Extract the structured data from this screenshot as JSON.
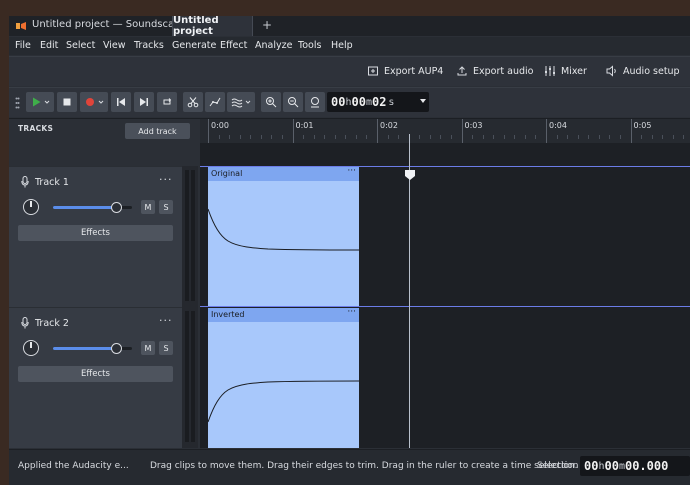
{
  "window": {
    "title": "Untitled project — Soundscaper",
    "project_tab": "Untitled project",
    "new_tab": "+"
  },
  "menu": [
    "File",
    "Edit",
    "Select",
    "View",
    "Tracks",
    "Generate",
    "Effect",
    "Analyze",
    "Tools",
    "Help"
  ],
  "actions": {
    "export_aup4": "Export AUP4",
    "export_audio": "Export audio",
    "mixer": "Mixer",
    "audio_setup": "Audio setup"
  },
  "timecode": {
    "h": "00",
    "h_unit": "h",
    "m": "00",
    "m_unit": "m",
    "s": "02",
    "s_unit": "s"
  },
  "tracks_header": {
    "label": "TRACKS",
    "add_track": "Add track"
  },
  "ruler": {
    "ticks": [
      "0:00",
      "0:01",
      "0:02",
      "0:03",
      "0:04",
      "0:05"
    ]
  },
  "tracks": [
    {
      "name": "Track 1",
      "menu": "···",
      "mute": "M",
      "solo": "S",
      "effects": "Effects",
      "volume": 0.8,
      "clip": {
        "name": "Original",
        "menu": "···"
      }
    },
    {
      "name": "Track 2",
      "menu": "···",
      "mute": "M",
      "solo": "S",
      "effects": "Effects",
      "volume": 0.8,
      "clip": {
        "name": "Inverted",
        "menu": "···"
      }
    }
  ],
  "status": {
    "left": "Applied the Audacity e...",
    "message": "Drag clips to move them. Drag their edges to trim. Drag in the ruler to create a time selection.",
    "selection_label": "Selection",
    "selection_h": "00",
    "selection_h_unit": "h",
    "selection_m": "00",
    "selection_m_unit": "m",
    "selection_s": "00.000"
  },
  "colors": {
    "accent": "#5b8dea",
    "clip": "#a8c8fb",
    "clip_header": "#7ea6f0",
    "play": "#3fae4a",
    "record": "#e0443a"
  }
}
